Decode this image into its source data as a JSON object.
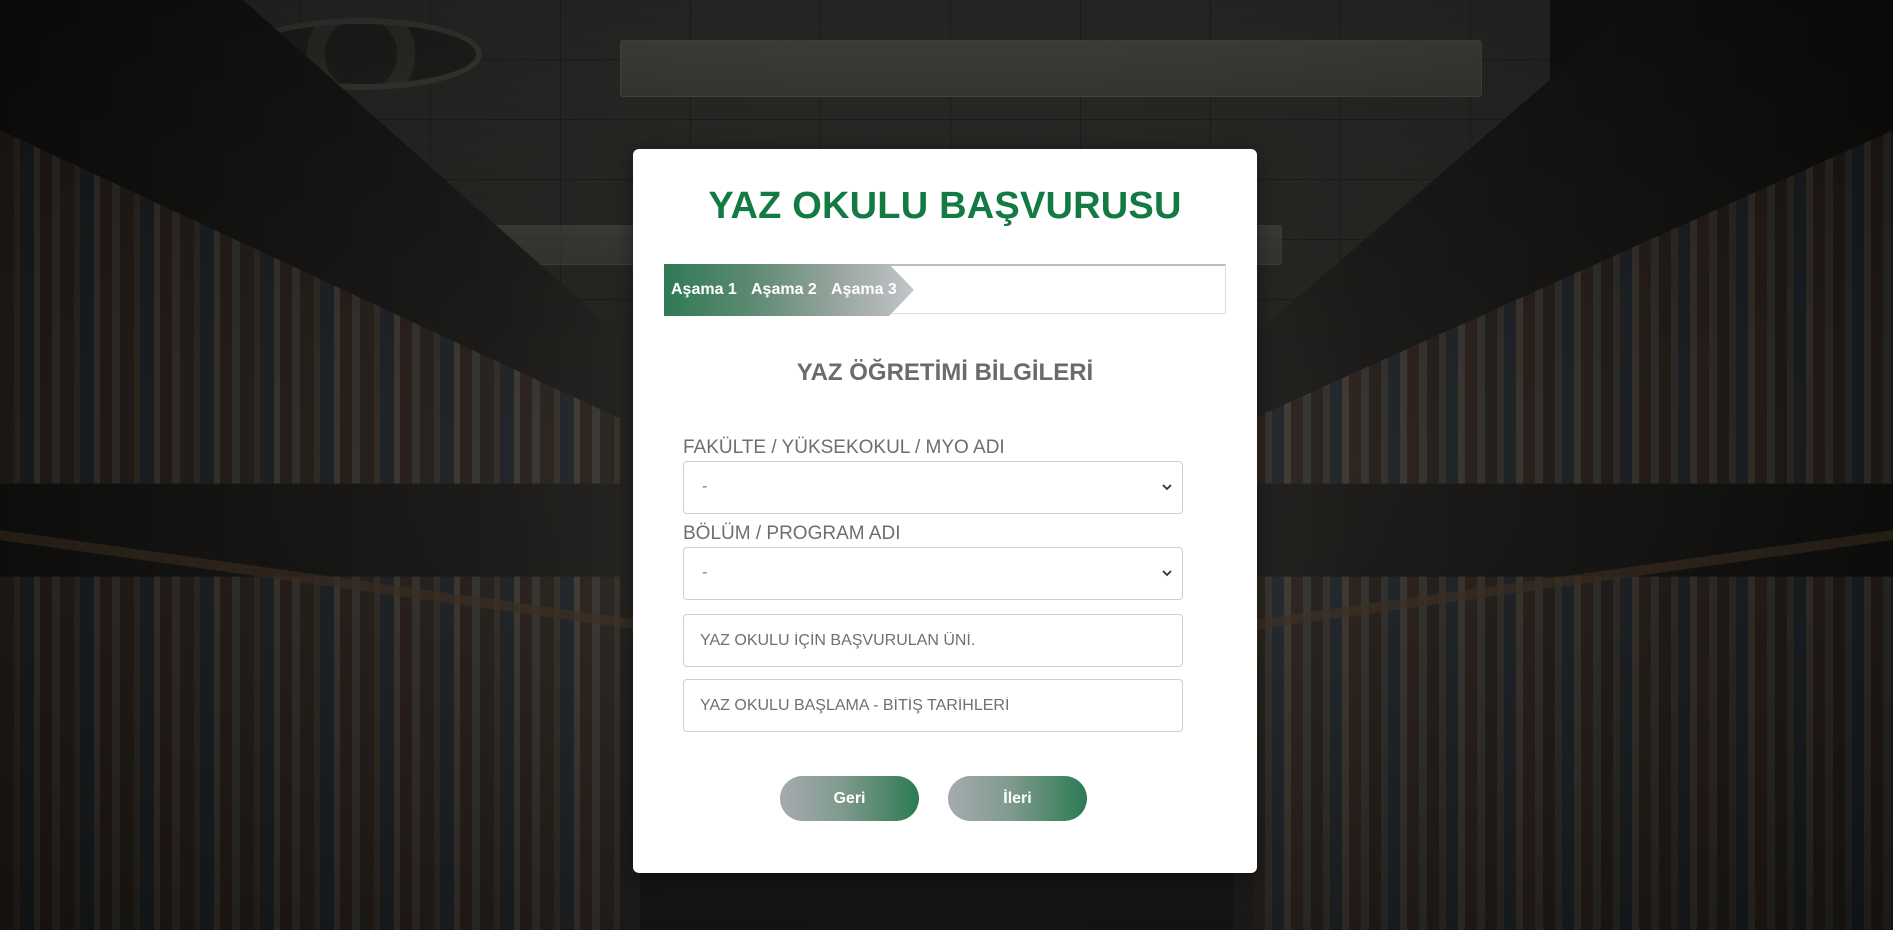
{
  "page": {
    "title": "YAZ OKULU BAŞVURUSU"
  },
  "stepper": {
    "steps": [
      "Aşama 1",
      "Aşama 2",
      "Aşama 3"
    ],
    "active_step": 1
  },
  "form": {
    "section_title": "YAZ ÖĞRETİMİ BİLGİLERİ",
    "faculty": {
      "label": "FAKÜLTE / YÜKSEKOKUL / MYO ADI",
      "selected": "-"
    },
    "department": {
      "label": "BÖLÜM / PROGRAM ADI",
      "selected": "-"
    },
    "university_input": {
      "placeholder": "YAZ OKULU İÇİN BAŞVURULAN ÜNİ.",
      "value": ""
    },
    "dates_input": {
      "placeholder": "YAZ OKULU BAŞLAMA - BİTİŞ TARİHLERİ",
      "value": ""
    }
  },
  "buttons": {
    "back_label": "Geri",
    "next_label": "İleri"
  },
  "colors": {
    "brand_green": "#137a44",
    "section_gray": "#6b6b6b"
  }
}
